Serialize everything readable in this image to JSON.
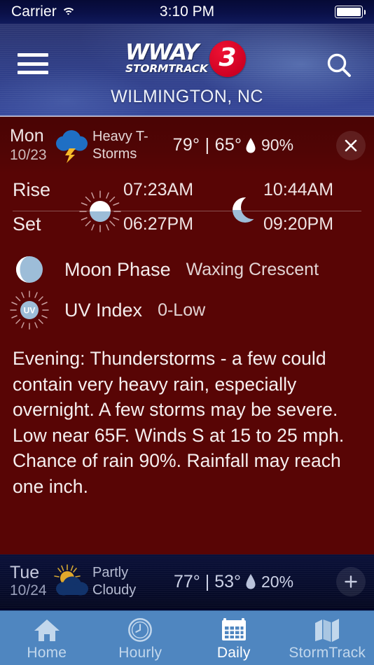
{
  "status_bar": {
    "carrier": "Carrier",
    "time": "3:10 PM",
    "wifi_icon": "wifi-icon",
    "battery_icon": "battery-full-icon"
  },
  "header": {
    "menu_icon": "hamburger-menu-icon",
    "search_icon": "search-icon",
    "logo": {
      "brand": "WWAY",
      "sub": "STORMTRACK",
      "channel": "3"
    },
    "location": "WILMINGTON, NC"
  },
  "selected_day": {
    "day_of_week": "Mon",
    "date": "10/23",
    "condition_icon": "thunderstorm-icon",
    "condition": "Heavy T-Storms",
    "condition_line1": "Heavy T-",
    "condition_line2": "Storms",
    "high": "79°",
    "separator": "|",
    "low": "65°",
    "temps": "79° | 65°",
    "precip_icon": "raindrop-icon",
    "precip_chance": "90%",
    "close_icon": "close-icon",
    "close_glyph": "✕"
  },
  "sun_moon": {
    "rise_label": "Rise",
    "set_label": "Set",
    "sun_icon": "sun-icon",
    "moon_icon": "moon-icon",
    "sunrise": "07:23AM",
    "sunset": "06:27PM",
    "moonrise": "10:44AM",
    "moonset": "09:20PM"
  },
  "details": [
    {
      "icon": "moon-phase-icon",
      "label": "Moon Phase",
      "value": "Waxing Crescent"
    },
    {
      "icon": "uv-index-icon",
      "label": "UV Index",
      "value": "0-Low",
      "icon_text": "UV"
    }
  ],
  "narrative": "Evening: Thunderstorms - a few could contain very heavy rain, especially overnight. A few storms may be severe. Low near 65F. Winds S at 15 to 25 mph. Chance of rain 90%. Rainfall may reach one inch.",
  "next_day": {
    "day_of_week": "Tue",
    "date": "10/24",
    "condition_icon": "partly-cloudy-icon",
    "condition": "Partly Cloudy",
    "condition_line1": "Partly",
    "condition_line2": "Cloudy",
    "high": "77°",
    "separator": "|",
    "low": "53°",
    "temps": "77° | 53°",
    "precip_icon": "raindrop-icon",
    "precip_chance": "20%",
    "expand_icon": "plus-icon",
    "expand_glyph": "+"
  },
  "tabs": [
    {
      "label": "Home",
      "icon": "home-icon",
      "active": false
    },
    {
      "label": "Hourly",
      "icon": "clock-icon",
      "active": false
    },
    {
      "label": "Daily",
      "icon": "calendar-icon",
      "active": true
    },
    {
      "label": "StormTrack",
      "icon": "map-icon",
      "active": false
    }
  ],
  "colors": {
    "panel_red": "#580505",
    "header_blue": "#2f3e86",
    "tabbar_blue": "#4f86c0",
    "accent_red": "#cc0022",
    "icon_blue": "#1f6fc4",
    "lightning_yellow": "#f5b92a",
    "moon_blue": "#9dbdd8"
  }
}
